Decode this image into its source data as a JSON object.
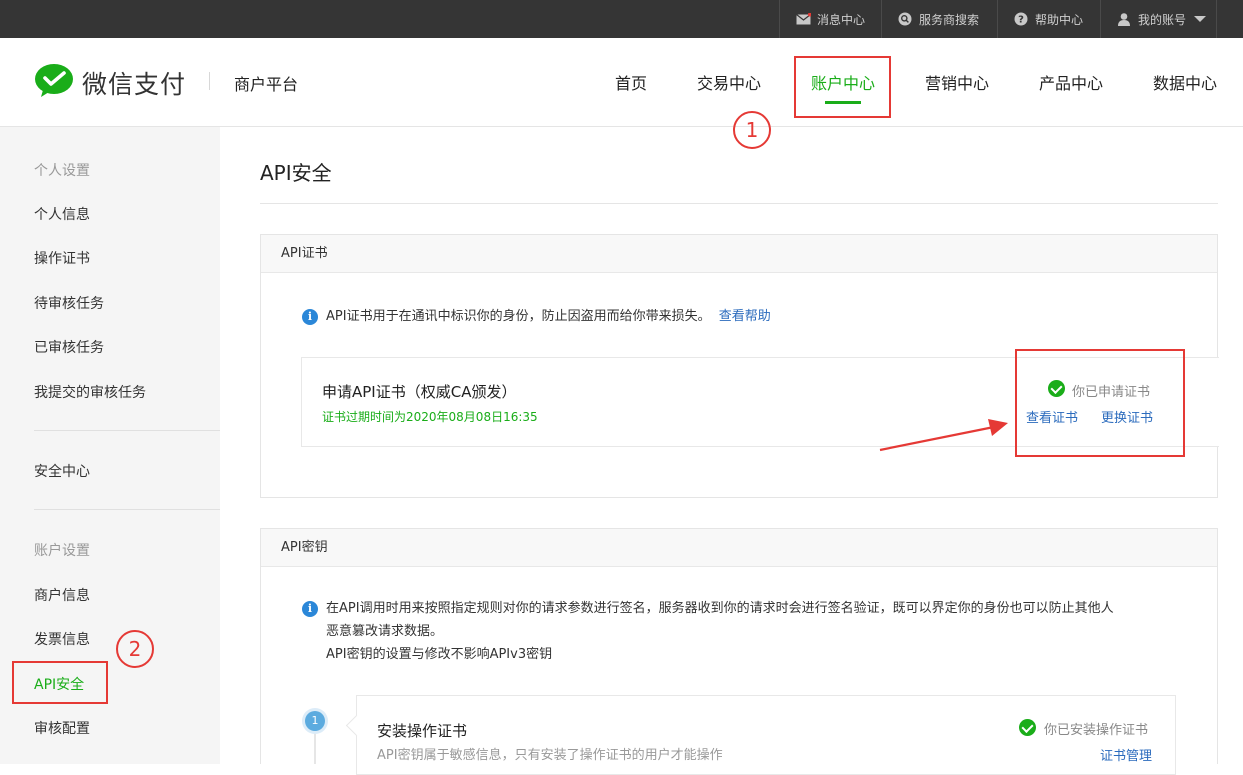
{
  "topbar": {
    "items": [
      {
        "label": "消息中心",
        "icon": "mail-icon"
      },
      {
        "label": "服务商搜索",
        "icon": "search-icon"
      },
      {
        "label": "帮助中心",
        "icon": "help-icon"
      },
      {
        "label": "我的账号",
        "icon": "user-icon"
      }
    ]
  },
  "header": {
    "logo_text": "微信支付",
    "platform": "商户平台",
    "nav": [
      {
        "label": "首页"
      },
      {
        "label": "交易中心"
      },
      {
        "label": "账户中心",
        "active": true
      },
      {
        "label": "营销中心"
      },
      {
        "label": "产品中心"
      },
      {
        "label": "数据中心"
      }
    ]
  },
  "sidebar": {
    "group1": "个人设置",
    "items1": [
      "个人信息",
      "操作证书",
      "待审核任务",
      "已审核任务",
      "我提交的审核任务"
    ],
    "security": "安全中心",
    "group2": "账户设置",
    "items2": [
      "商户信息",
      "发票信息",
      "API安全",
      "审核配置"
    ]
  },
  "main": {
    "title": "API安全",
    "cert_panel": {
      "head": "API证书",
      "info": "API证书用于在通讯中标识你的身份，防止因盗用而给你带来损失。",
      "help_link": "查看帮助",
      "cert_title": "申请API证书（权威CA颁发）",
      "expire": "证书过期时间为2020年08月08日16:35",
      "status": "你已申请证书",
      "view": "查看证书",
      "replace": "更换证书"
    },
    "key_panel": {
      "head": "API密钥",
      "info_line1": "在API调用时用来按照指定规则对你的请求参数进行签名，服务器收到你的请求时会进行签名验证，既可以界定你的身份也可以防止其他人",
      "info_line2": "恶意篡改请求数据。",
      "info_line3": "API密钥的设置与修改不影响APIv3密钥",
      "step_number": "1",
      "step_title": "安装操作证书",
      "step_desc": "API密钥属于敏感信息，只有安装了操作证书的用户才能操作",
      "step_status": "你已安装操作证书",
      "step_link": "证书管理"
    }
  },
  "annotations": {
    "circle1": "1",
    "circle2": "2"
  },
  "colors": {
    "accent": "#1aad19",
    "link": "#2b6bbd",
    "annotation": "#e53935"
  }
}
